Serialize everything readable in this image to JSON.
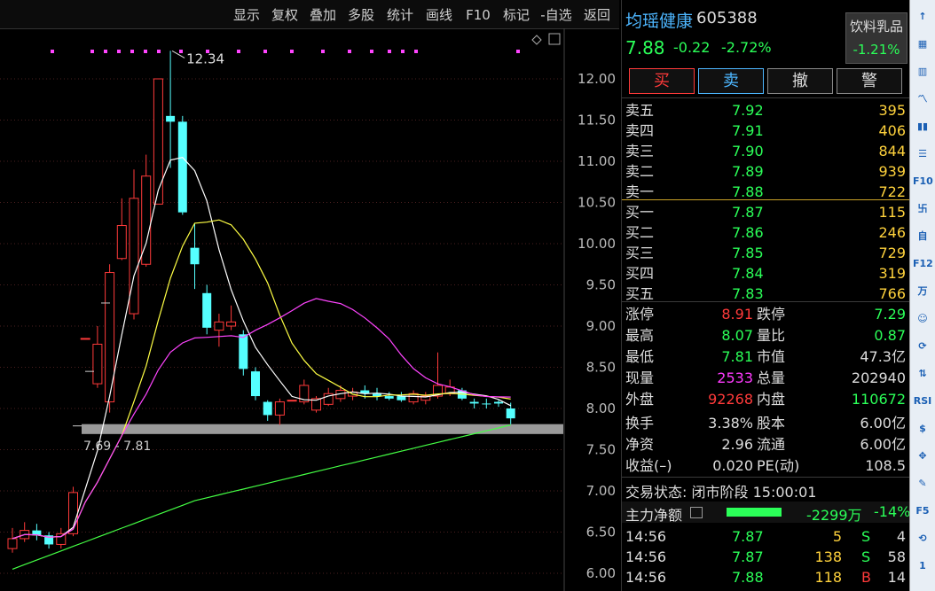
{
  "toolbar": {
    "buttons": [
      "显示",
      "复权",
      "叠加",
      "多股",
      "统计",
      "画线",
      "F10",
      "标记",
      "-自选",
      "返回"
    ]
  },
  "chart_data": {
    "type": "candlestick",
    "price_axis": {
      "min": 6.0,
      "max": 12.0,
      "ticks": [
        "12.00",
        "11.50",
        "11.00",
        "10.50",
        "10.00",
        "9.50",
        "9.00",
        "8.50",
        "8.00",
        "7.50",
        "7.00",
        "6.50",
        "6.00"
      ]
    },
    "annotations": {
      "high_label": "12.34",
      "range_label": "7.69 - 7.81"
    },
    "candles": [
      {
        "o": 6.3,
        "c": 6.42,
        "h": 6.55,
        "l": 6.25
      },
      {
        "o": 6.42,
        "c": 6.52,
        "h": 6.62,
        "l": 6.38
      },
      {
        "o": 6.52,
        "c": 6.46,
        "h": 6.6,
        "l": 6.4
      },
      {
        "o": 6.46,
        "c": 6.35,
        "h": 6.5,
        "l": 6.3
      },
      {
        "o": 6.35,
        "c": 6.48,
        "h": 6.55,
        "l": 6.3
      },
      {
        "o": 6.48,
        "c": 6.98,
        "h": 7.05,
        "l": 6.45
      },
      {
        "o": 8.85,
        "c": 8.85,
        "h": 8.85,
        "l": 8.85
      },
      {
        "o": 8.3,
        "c": 8.78,
        "h": 9.0,
        "l": 8.25
      },
      {
        "o": 8.08,
        "c": 9.65,
        "h": 9.75,
        "l": 7.95
      },
      {
        "o": 9.82,
        "c": 10.22,
        "h": 10.55,
        "l": 9.8
      },
      {
        "o": 9.15,
        "c": 10.55,
        "h": 10.9,
        "l": 9.08
      },
      {
        "o": 9.75,
        "c": 10.82,
        "h": 11.08,
        "l": 9.72
      },
      {
        "o": 10.48,
        "c": 12.0,
        "h": 12.0,
        "l": 10.48
      },
      {
        "o": 11.55,
        "c": 11.48,
        "h": 12.34,
        "l": 10.92
      },
      {
        "o": 11.48,
        "c": 10.38,
        "h": 11.55,
        "l": 10.35
      },
      {
        "o": 9.95,
        "c": 9.75,
        "h": 10.25,
        "l": 9.45
      },
      {
        "o": 9.4,
        "c": 8.98,
        "h": 9.5,
        "l": 8.9
      },
      {
        "o": 8.95,
        "c": 9.05,
        "h": 9.15,
        "l": 8.75
      },
      {
        "o": 9.0,
        "c": 9.05,
        "h": 9.25,
        "l": 8.95
      },
      {
        "o": 8.9,
        "c": 8.48,
        "h": 8.95,
        "l": 8.4
      },
      {
        "o": 8.45,
        "c": 8.15,
        "h": 8.5,
        "l": 8.1
      },
      {
        "o": 8.08,
        "c": 7.92,
        "h": 8.1,
        "l": 7.85
      },
      {
        "o": 7.92,
        "c": 8.08,
        "h": 8.12,
        "l": 7.8
      },
      {
        "o": 8.1,
        "c": 8.1,
        "h": 8.1,
        "l": 8.1
      },
      {
        "o": 8.08,
        "c": 8.28,
        "h": 8.35,
        "l": 8.05
      },
      {
        "o": 7.98,
        "c": 8.12,
        "h": 8.15,
        "l": 7.95
      },
      {
        "o": 8.05,
        "c": 8.18,
        "h": 8.25,
        "l": 8.03
      },
      {
        "o": 8.12,
        "c": 8.22,
        "h": 8.28,
        "l": 8.08
      },
      {
        "o": 8.15,
        "c": 8.2,
        "h": 8.25,
        "l": 8.1
      },
      {
        "o": 8.22,
        "c": 8.18,
        "h": 8.28,
        "l": 8.12
      },
      {
        "o": 8.18,
        "c": 8.15,
        "h": 8.25,
        "l": 8.1
      },
      {
        "o": 8.15,
        "c": 8.12,
        "h": 8.2,
        "l": 8.1
      },
      {
        "o": 8.15,
        "c": 8.1,
        "h": 8.2,
        "l": 8.08
      },
      {
        "o": 8.08,
        "c": 8.18,
        "h": 8.22,
        "l": 8.05
      },
      {
        "o": 8.1,
        "c": 8.15,
        "h": 8.2,
        "l": 8.05
      },
      {
        "o": 8.15,
        "c": 8.28,
        "h": 8.68,
        "l": 8.12
      },
      {
        "o": 8.18,
        "c": 8.26,
        "h": 8.35,
        "l": 8.15
      },
      {
        "o": 8.22,
        "c": 8.12,
        "h": 8.25,
        "l": 8.1
      },
      {
        "o": 8.08,
        "c": 8.06,
        "h": 8.12,
        "l": 8.0
      },
      {
        "o": 8.06,
        "c": 8.05,
        "h": 8.12,
        "l": 8.0
      },
      {
        "o": 8.08,
        "c": 8.06,
        "h": 8.1,
        "l": 8.02
      },
      {
        "o": 8.0,
        "c": 7.88,
        "h": 8.07,
        "l": 7.81
      }
    ],
    "support_band": {
      "low": 7.69,
      "high": 7.81
    },
    "ma_colors": {
      "ma5": "#ffffff",
      "ma10": "#ffff44",
      "ma20": "#ff44ff",
      "ma60": "#44ff44"
    }
  },
  "stock": {
    "name": "均瑶健康",
    "code": "605388",
    "price": "7.88",
    "change": "-0.22",
    "change_pct": "-2.72%",
    "industry": "饮料乳品",
    "industry_change": "-1.21%"
  },
  "trade_buttons": [
    "买",
    "卖",
    "撤",
    "警"
  ],
  "order_book": {
    "sell": [
      {
        "label": "卖五",
        "price": "7.92",
        "vol": "395"
      },
      {
        "label": "卖四",
        "price": "7.91",
        "vol": "406"
      },
      {
        "label": "卖三",
        "price": "7.90",
        "vol": "844"
      },
      {
        "label": "卖二",
        "price": "7.89",
        "vol": "939"
      },
      {
        "label": "卖一",
        "price": "7.88",
        "vol": "722"
      }
    ],
    "buy": [
      {
        "label": "买一",
        "price": "7.87",
        "vol": "115"
      },
      {
        "label": "买二",
        "price": "7.86",
        "vol": "246"
      },
      {
        "label": "买三",
        "price": "7.85",
        "vol": "729"
      },
      {
        "label": "买四",
        "price": "7.84",
        "vol": "319"
      },
      {
        "label": "买五",
        "price": "7.83",
        "vol": "766"
      }
    ]
  },
  "stats": [
    {
      "l1": "涨停",
      "v1": "8.91",
      "c1": "red",
      "l2": "跌停",
      "v2": "7.29",
      "c2": "green"
    },
    {
      "l1": "最高",
      "v1": "8.07",
      "c1": "green",
      "l2": "量比",
      "v2": "0.87",
      "c2": "green"
    },
    {
      "l1": "最低",
      "v1": "7.81",
      "c1": "green",
      "l2": "市值",
      "v2": "47.3亿",
      "c2": "white"
    },
    {
      "l1": "现量",
      "v1": "2533",
      "c1": "magenta",
      "l2": "总量",
      "v2": "202940",
      "c2": "white"
    },
    {
      "l1": "外盘",
      "v1": "92268",
      "c1": "red",
      "l2": "内盘",
      "v2": "110672",
      "c2": "green"
    },
    {
      "l1": "换手",
      "v1": "3.38%",
      "c1": "white",
      "l2": "股本",
      "v2": "6.00亿",
      "c2": "white"
    },
    {
      "l1": "净资",
      "v1": "2.96",
      "c1": "white",
      "l2": "流通",
      "v2": "6.00亿",
      "c2": "white"
    },
    {
      "l1": "收益(–)",
      "v1": "0.020",
      "c1": "white",
      "l2": "PE(动)",
      "v2": "108.5",
      "c2": "white"
    }
  ],
  "status": {
    "label": "交易状态:",
    "value": "闭市阶段 15:00:01"
  },
  "main_flow": {
    "label": "主力净额",
    "value": "-2299万",
    "pct": "-14%"
  },
  "ticks": [
    {
      "time": "14:56",
      "price": "7.87",
      "vol": "5",
      "side": "S",
      "num": "4"
    },
    {
      "time": "14:56",
      "price": "7.87",
      "vol": "138",
      "side": "S",
      "num": "58"
    },
    {
      "time": "14:56",
      "price": "7.88",
      "vol": "118",
      "side": "B",
      "num": "14"
    }
  ],
  "right_tools": [
    "↑",
    "▦",
    "▥",
    "〽",
    "▮▮",
    "☰",
    "F10",
    "卐",
    "自",
    "F12",
    "万",
    "☺",
    "⟳",
    "⇅",
    "RSI",
    "$",
    "✥",
    "✎",
    "F5",
    "⟲",
    "1"
  ]
}
